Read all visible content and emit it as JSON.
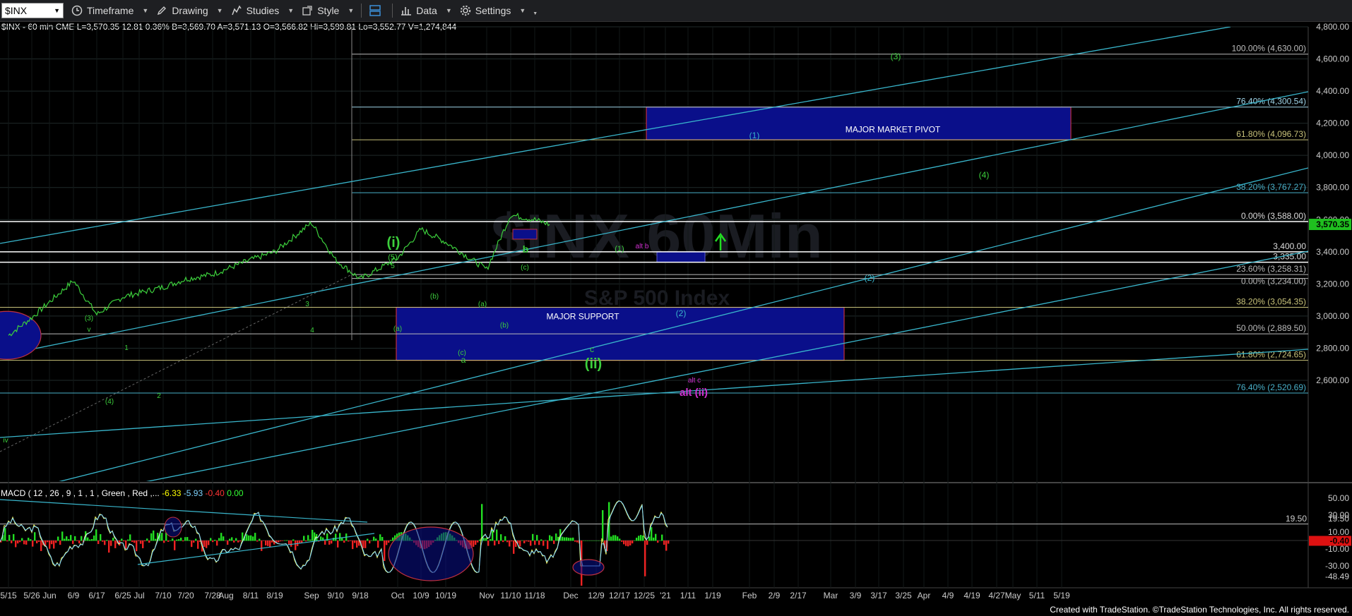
{
  "toolbar": {
    "symbol": "$INX",
    "timeframe": "Timeframe",
    "drawing": "Drawing",
    "studies": "Studies",
    "style": "Style",
    "data": "Data",
    "settings": "Settings"
  },
  "info_line": "$INX - 60 min  CME  L=3,570.35  12.81  0.36%  B=3,569.70  A=3,571.13  O=3,566.82  Hi=3,589.81  Lo=3,552.77  V=1,274,844",
  "watermark": {
    "title": "$INX 60Min",
    "subtitle": "S&P 500 Index"
  },
  "macd_line": {
    "label": "MACD ( 12 , 26 , 9 , 1 , 1 , Green , Red ,... ",
    "v1": "-6.33",
    "v2": "-5.93",
    "v3": "-0.40",
    "v4": "0.00"
  },
  "footer": "Created with TradeStation. ©TradeStation Technologies, Inc. All rights reserved.",
  "colors": {
    "price": "#3ccf3c",
    "channel": "#39b6cc",
    "box_fill": "#0a0f8a",
    "box_border": "#c0303f",
    "grid": "#1f2a2a",
    "axis_text": "#cccccc",
    "last_price_bg": "#1fbf1f",
    "wave_green": "#3ccf3c",
    "wave_magenta": "#d130d1"
  },
  "chart_data": {
    "type": "line",
    "title": "$INX - 60 min",
    "x_ticks": [
      "5/15",
      "5/26",
      "Jun",
      "6/9",
      "6/17",
      "6/25",
      "Jul",
      "7/10",
      "7/20",
      "7/28",
      "Aug",
      "8/11",
      "8/19",
      "Sep",
      "9/10",
      "9/18",
      "Oct",
      "10/9",
      "10/19",
      "Nov",
      "11/10",
      "11/18",
      "Dec",
      "12/9",
      "12/17",
      "12/25",
      "'21",
      "1/11",
      "1/19",
      "Feb",
      "2/9",
      "2/17",
      "Mar",
      "3/9",
      "3/17",
      "3/25",
      "Apr",
      "4/9",
      "4/19",
      "4/27",
      "May",
      "5/11",
      "5/19"
    ],
    "y_ticks": [
      "4,800.00",
      "4,600.00",
      "4,400.00",
      "4,200.00",
      "4,000.00",
      "3,800.00",
      "3,600.00",
      "3,400.00",
      "3,200.00",
      "3,000.00",
      "2,800.00",
      "2,600.00"
    ],
    "ylim": [
      2500,
      4850
    ],
    "last_price": "3,570.35",
    "series": [
      {
        "x": [
          "5/15",
          "5/26",
          "6/9",
          "6/17",
          "6/25",
          "7/10",
          "7/20",
          "7/28",
          "8/11",
          "8/19",
          "Sep",
          "9/10",
          "9/18",
          "Oct",
          "10/9",
          "10/19",
          "Nov",
          "11/10",
          "11/18",
          "11/20"
        ],
        "values": [
          2880,
          2990,
          3220,
          3010,
          3120,
          3180,
          3230,
          3260,
          3350,
          3400,
          3580,
          3350,
          3230,
          3360,
          3540,
          3460,
          3290,
          3630,
          3600,
          3570
        ]
      }
    ],
    "horizontal_levels": [
      {
        "label": "100.00% (4,630.00)",
        "value": 4630
      },
      {
        "label": "76.40% (4,300.54)",
        "value": 4300.54
      },
      {
        "label": "61.80% (4,096.73)",
        "value": 4096.73
      },
      {
        "label": "38.20% (3,767.27)",
        "value": 3767.27
      },
      {
        "label": "0.00% (3,588.00)",
        "value": 3588
      },
      {
        "label": "3,400.00",
        "value": 3400
      },
      {
        "label": "3,335.00",
        "value": 3335
      },
      {
        "label": "23.60% (3,258.31)",
        "value": 3258.31
      },
      {
        "label": "0.00% (3,234.00)",
        "value": 3234
      },
      {
        "label": "38.20% (3,054.35)",
        "value": 3054.35
      },
      {
        "label": "50.00% (2,889.50)",
        "value": 2889.5
      },
      {
        "label": "61.80% (2,724.65)",
        "value": 2724.65
      },
      {
        "label": "76.40% (2,520.69)",
        "value": 2520.69
      }
    ],
    "zones": [
      {
        "label": "MAJOR MARKET PIVOT",
        "from": 4096.73,
        "to": 4300.54
      },
      {
        "label": "MAJOR SUPPORT",
        "from": 2724.65,
        "to": 3054.35
      }
    ],
    "wave_labels": [
      "(3)",
      "(1)",
      "(4)",
      "(2)",
      "(2)",
      "(i)",
      "(5)",
      "5",
      "b",
      "(c)",
      "(1)",
      "alt b",
      "(3)",
      "v",
      "1",
      "(4)",
      "2",
      "3",
      "4",
      "(a)",
      "(b)",
      "(c)",
      "a",
      "(a)",
      "(b)",
      "c",
      "(ii)",
      "alt c",
      "alt (ii)",
      "iv"
    ],
    "macd": {
      "ylim": [
        -55,
        55
      ],
      "y_ticks": [
        "50.00",
        "30.00",
        "19.50",
        "10.00",
        "-10.00",
        "-30.00",
        "-48.49"
      ],
      "current": "-0.40"
    }
  }
}
